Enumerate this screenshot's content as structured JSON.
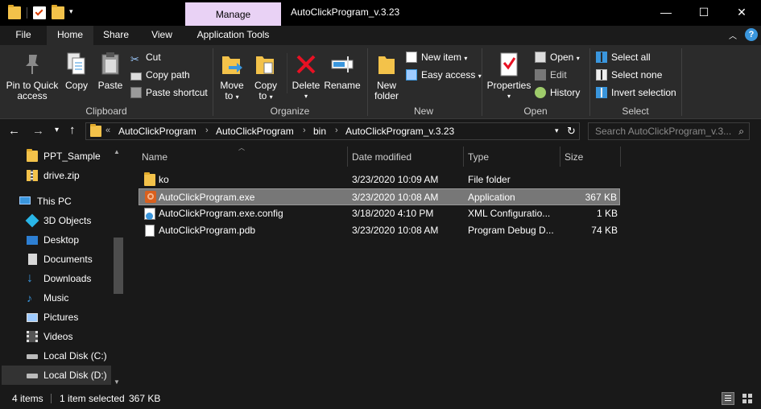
{
  "window": {
    "title": "AutoClickProgram_v.3.23",
    "context_tab": "Manage",
    "controls": {
      "minimize": "—",
      "maximize": "☐",
      "close": "✕"
    }
  },
  "ribbon_tabs": [
    "File",
    "Home",
    "Share",
    "View",
    "Application Tools"
  ],
  "ribbon": {
    "clipboard": {
      "label": "Clipboard",
      "pin": "Pin to Quick",
      "pin2": "access",
      "copy": "Copy",
      "paste": "Paste",
      "cut": "Cut",
      "copy_path": "Copy path",
      "paste_shortcut": "Paste shortcut"
    },
    "organize": {
      "label": "Organize",
      "move": "Move",
      "move2": "to",
      "copy": "Copy",
      "copy2": "to",
      "delete": "Delete",
      "rename": "Rename"
    },
    "new": {
      "label": "New",
      "new_folder": "New",
      "new_folder2": "folder",
      "new_item": "New item",
      "easy_access": "Easy access"
    },
    "open": {
      "label": "Open",
      "properties": "Properties",
      "open": "Open",
      "edit": "Edit",
      "history": "History"
    },
    "select": {
      "label": "Select",
      "select_all": "Select all",
      "select_none": "Select none",
      "invert": "Invert selection"
    }
  },
  "address": {
    "overflow": "«",
    "crumbs": [
      "AutoClickProgram",
      "AutoClickProgram",
      "bin",
      "AutoClickProgram_v.3.23"
    ],
    "search_placeholder": "Search AutoClickProgram_v.3..."
  },
  "nav_pane": [
    {
      "label": "PPT_Sample",
      "icon": "folder-icon"
    },
    {
      "label": "drive.zip",
      "icon": "zip-icon"
    },
    {
      "label": "This PC",
      "icon": "pc-icon"
    },
    {
      "label": "3D Objects",
      "icon": "3d-objects-icon"
    },
    {
      "label": "Desktop",
      "icon": "desktop-icon"
    },
    {
      "label": "Documents",
      "icon": "documents-icon"
    },
    {
      "label": "Downloads",
      "icon": "downloads-icon"
    },
    {
      "label": "Music",
      "icon": "music-icon"
    },
    {
      "label": "Pictures",
      "icon": "pictures-icon"
    },
    {
      "label": "Videos",
      "icon": "videos-icon"
    },
    {
      "label": "Local Disk (C:)",
      "icon": "disk-icon"
    },
    {
      "label": "Local Disk (D:)",
      "icon": "disk-icon"
    }
  ],
  "columns": [
    "Name",
    "Date modified",
    "Type",
    "Size"
  ],
  "files": [
    {
      "name": "ko",
      "date": "3/23/2020 10:09 AM",
      "type": "File folder",
      "size": "",
      "icon": "folder-icon"
    },
    {
      "name": "AutoClickProgram.exe",
      "date": "3/23/2020 10:08 AM",
      "type": "Application",
      "size": "367 KB",
      "icon": "exe-icon"
    },
    {
      "name": "AutoClickProgram.exe.config",
      "date": "3/18/2020 4:10 PM",
      "type": "XML Configuratio...",
      "size": "1 KB",
      "icon": "config-icon"
    },
    {
      "name": "AutoClickProgram.pdb",
      "date": "3/23/2020 10:08 AM",
      "type": "Program Debug D...",
      "size": "74 KB",
      "icon": "file-icon"
    }
  ],
  "status": {
    "items": "4 items",
    "selected": "1 item selected",
    "size": "367 KB"
  },
  "colors": {
    "manage_tab": "#e9d2f5",
    "selection": "#777777",
    "folder": "#f3c24a",
    "delete_red": "#e81123",
    "accent_blue": "#3a96dd"
  }
}
